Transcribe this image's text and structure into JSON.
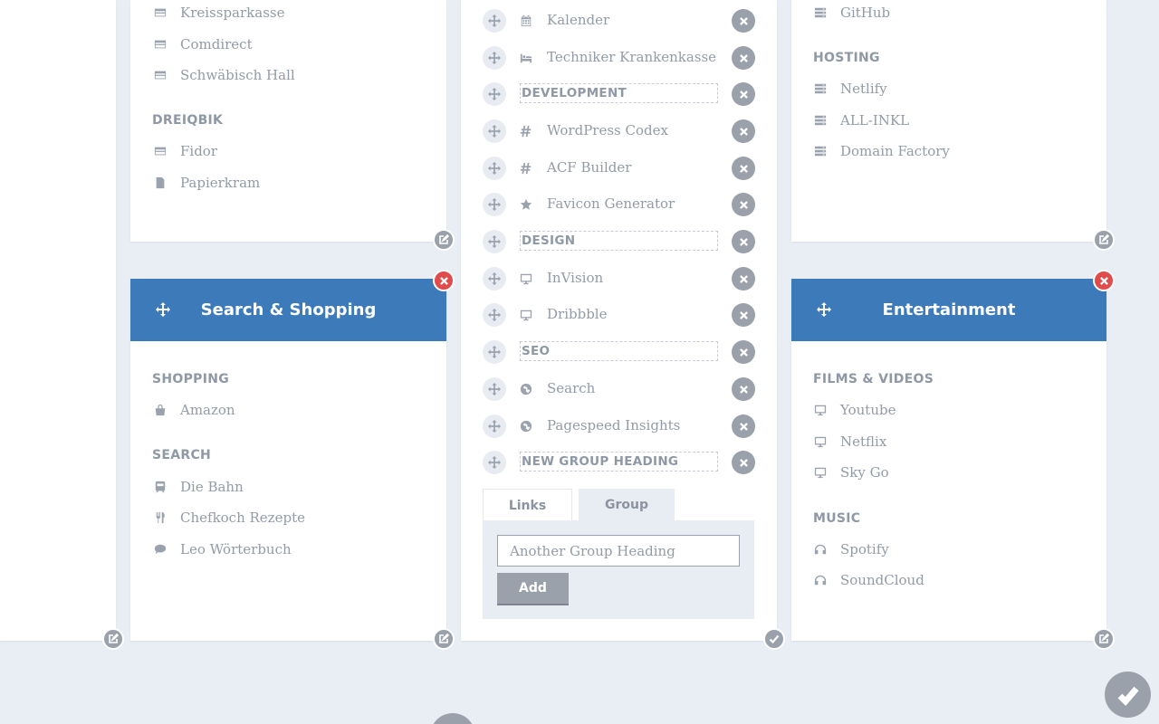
{
  "left_top_card": {
    "items": [
      {
        "label": "Kreissparkasse",
        "icon": "credit-card-icon"
      },
      {
        "label": "Comdirect",
        "icon": "credit-card-icon"
      },
      {
        "label": "Schwäbisch Hall",
        "icon": "credit-card-icon"
      }
    ],
    "group2_heading": "DREIQBIK",
    "group2_items": [
      {
        "label": "Fidor",
        "icon": "credit-card-icon"
      },
      {
        "label": "Papierkram",
        "icon": "document-icon"
      }
    ]
  },
  "search_shopping": {
    "title": "Search & Shopping",
    "shopping_heading": "SHOPPING",
    "shopping_items": [
      {
        "label": "Amazon",
        "icon": "shopping-bag-icon"
      }
    ],
    "search_heading": "SEARCH",
    "search_items": [
      {
        "label": "Die Bahn",
        "icon": "train-icon"
      },
      {
        "label": "Chefkoch Rezepte",
        "icon": "cutlery-icon"
      },
      {
        "label": "Leo Wörterbuch",
        "icon": "speech-bubble-icon"
      }
    ]
  },
  "editor": {
    "rows": [
      {
        "type": "link",
        "label": "Kalender",
        "icon": "calendar-icon"
      },
      {
        "type": "link",
        "label": "Techniker Krankenkasse",
        "icon": "bed-icon"
      },
      {
        "type": "heading",
        "label": "DEVELOPMENT"
      },
      {
        "type": "link",
        "label": "WordPress Codex",
        "icon": "hashtag-icon"
      },
      {
        "type": "link",
        "label": "ACF Builder",
        "icon": "hashtag-icon"
      },
      {
        "type": "link",
        "label": "Favicon Generator",
        "icon": "star-icon"
      },
      {
        "type": "heading",
        "label": "DESIGN"
      },
      {
        "type": "link",
        "label": "InVision",
        "icon": "desktop-icon"
      },
      {
        "type": "link",
        "label": "Dribbble",
        "icon": "desktop-icon"
      },
      {
        "type": "heading",
        "label": "SEO"
      },
      {
        "type": "link",
        "label": "Search",
        "icon": "globe-icon"
      },
      {
        "type": "link",
        "label": "Pagespeed Insights",
        "icon": "globe-icon"
      },
      {
        "type": "heading",
        "label": "NEW GROUP HEADING"
      }
    ],
    "tabs": {
      "links": "Links",
      "group": "Group"
    },
    "input_value": "Another Group Heading",
    "add_label": "Add"
  },
  "right_top_card": {
    "items": [
      {
        "label": "GitHub",
        "icon": "server-icon"
      }
    ],
    "hosting_heading": "HOSTING",
    "hosting_items": [
      {
        "label": "Netlify",
        "icon": "server-icon"
      },
      {
        "label": "ALL-INKL",
        "icon": "server-icon"
      },
      {
        "label": "Domain Factory",
        "icon": "server-icon"
      }
    ]
  },
  "entertainment": {
    "title": "Entertainment",
    "films_heading": "FILMS & VIDEOS",
    "films_items": [
      {
        "label": "Youtube",
        "icon": "monitor-icon"
      },
      {
        "label": "Netflix",
        "icon": "monitor-icon"
      },
      {
        "label": "Sky Go",
        "icon": "monitor-icon"
      }
    ],
    "music_heading": "MUSIC",
    "music_items": [
      {
        "label": "Spotify",
        "icon": "headphones-icon"
      },
      {
        "label": "SoundCloud",
        "icon": "headphones-icon"
      }
    ]
  },
  "colors": {
    "accent": "#3d7ab9",
    "danger": "#e04b4b",
    "muted": "#9aa1ab",
    "background": "#e9edf4"
  }
}
